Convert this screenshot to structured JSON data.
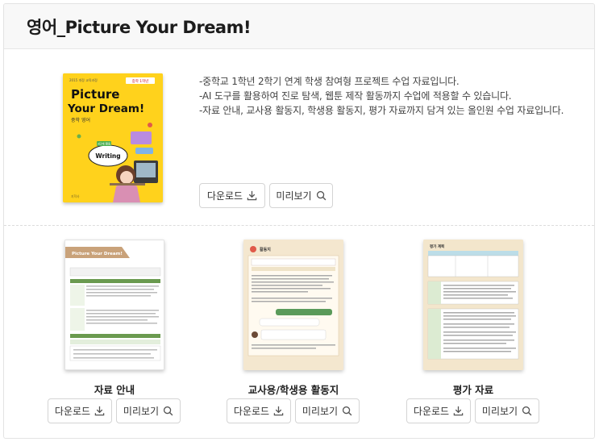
{
  "header": {
    "title": "영어_Picture Your Dream!"
  },
  "main": {
    "cover": {
      "tag": "2015 개정 교육과정",
      "grade_badge": "중학 1학년",
      "title_line1": "Picture",
      "title_line2": "Your Dream!",
      "subtitle": "중학 영어",
      "step": "3단계 활동",
      "bubble": "Writing",
      "publisher": "지학사"
    },
    "description": [
      "-중학교 1학년 2학기 연계 학생 참여형 프로젝트 수업 자료입니다.",
      "-AI 도구를 활용하여 진로 탐색, 웹툰 제작 활동까지 수업에 적용할 수 있습니다.",
      "-자료 안내, 교사용 활동지, 학생용 활동지, 평가 자료까지 담겨 있는 올인원 수업 자료입니다."
    ],
    "download_label": "다운로드",
    "preview_label": "미리보기",
    "items": [
      {
        "label": "자료 안내",
        "doc_title": "Picture Your Dream!"
      },
      {
        "label": "교사용/학생용 활동지",
        "doc_title": "활동지"
      },
      {
        "label": "평가 자료",
        "doc_title": "평가 계획"
      }
    ]
  },
  "colors": {
    "accent_yellow": "#ffd21c",
    "doc_beige": "#f4e7cf",
    "doc_green": "#5a8a46",
    "doc_brown": "#b18b5b",
    "button_border": "#d4d4d4"
  }
}
